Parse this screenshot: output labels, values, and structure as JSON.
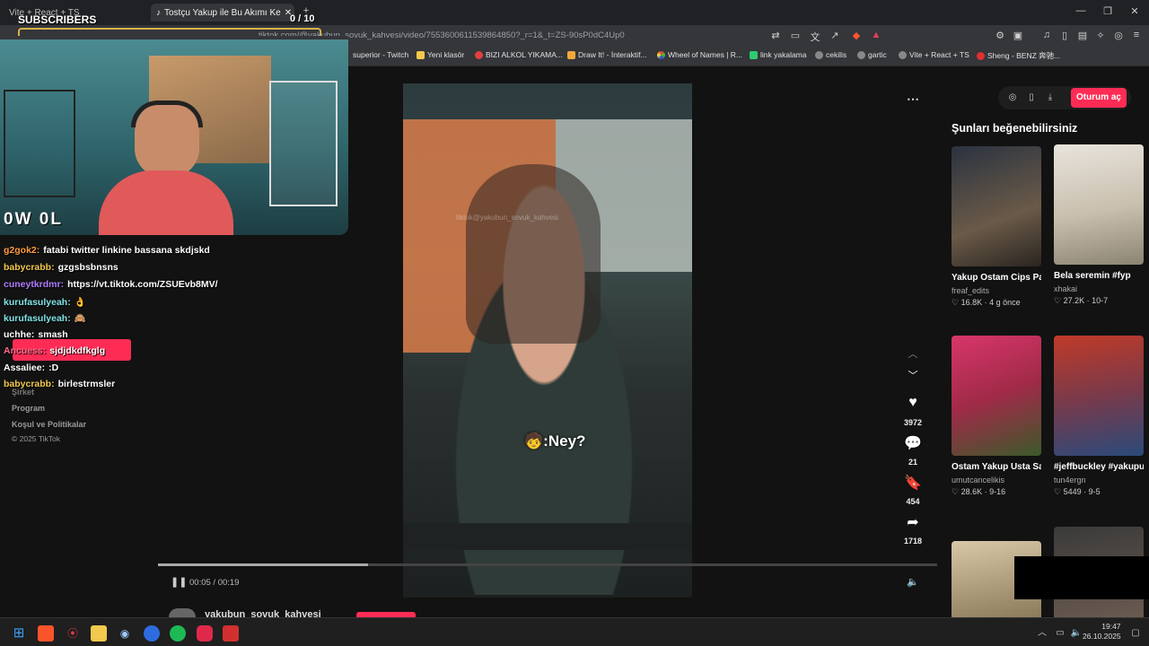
{
  "browser": {
    "tabs": [
      {
        "title": "Vite + React + TS"
      },
      {
        "title": "Tostçu Yakup ile Bu Akımı Ke"
      }
    ],
    "url": "tiktok.com/@yakubun_sovuk_kahvesi/video/7553600611539864850?_r=1&_t=ZS-90sP0dC4Up0",
    "bookmarks": [
      "superior - Twitch",
      "Yeni klasör",
      "BIZI ALKOL YIKAMA...",
      "Draw It! - İnteraktif...",
      "Wheel of Names | R...",
      "link yakalama",
      "cekilis",
      "gartic",
      "Vite + React + TS",
      "Sheng - BENZ 奔驰..."
    ]
  },
  "stream_overlay": {
    "subscribers_label": "SUBSCRIBERS",
    "subscriber_count": "0 / 10",
    "owl_label": "0W 0L",
    "chat": [
      {
        "user": "g2gok2:",
        "msg": "fatabi twitter linkine bassana skdjskd",
        "color": "#ff9a3c"
      },
      {
        "user": "babycrabb:",
        "msg": "gzgsbsbnsns",
        "color": "#f2c94c"
      },
      {
        "user": "cuneytkrdmr:",
        "msg": "https://vt.tiktok.com/ZSUEvb8MV/",
        "color": "#b07cff"
      },
      {
        "user": "kurufasulyeah:",
        "msg": "👌",
        "color": "#7fe3e6"
      },
      {
        "user": "kurufasulyeah:",
        "msg": "🙈",
        "color": "#7fe3e6"
      },
      {
        "user": "uchhe:",
        "msg": "smash",
        "color": "#ffffff"
      },
      {
        "user": "Ancuess:",
        "msg": "sjdjdkdfkglg",
        "color": "#ff6b8a"
      },
      {
        "user": "Assaliee:",
        "msg": ":D",
        "color": "#ffffff"
      },
      {
        "user": "babycrabb:",
        "msg": "birlestrmsler",
        "color": "#f2c94c"
      }
    ]
  },
  "sidebar_links": [
    "Şirket",
    "Program",
    "Koşul ve Politikalar",
    "© 2025 TikTok"
  ],
  "video": {
    "caption": ":Ney?",
    "watermark": "tiktok@yakubun_sovuk_kahvesi",
    "time": "00:05 / 00:19",
    "progress": 0.27,
    "likes": "3972",
    "comments": "21",
    "saves": "454",
    "shares": "1718",
    "author": "yakubun_sovuk_kahvesi"
  },
  "right": {
    "login_label": "Oturum aç",
    "suggest_title": "Şunları beğenebilirsiniz",
    "cards": [
      {
        "title": "Yakup Ostam Cips Patlatıyor(: #yakup...",
        "user": "freaf_edits",
        "stats": "♡ 16.8K · 4 g önce"
      },
      {
        "title": "Bela seremin #fyp",
        "user": "xhakai",
        "stats": "♡ 27.2K · 10-7"
      },
      {
        "title": "Ostam Yakup Usta Savuk Kahve Edit ...",
        "user": "umutcancelikis",
        "stats": "♡ 28.6K · 9-16"
      },
      {
        "title": "#jeffbuckley #yakupusta #müzi...",
        "user": "tun4ergn",
        "stats": "♡ 5449 · 9-5"
      }
    ]
  },
  "taskbar": {
    "time": "19:47",
    "date": "26.10.2025"
  }
}
